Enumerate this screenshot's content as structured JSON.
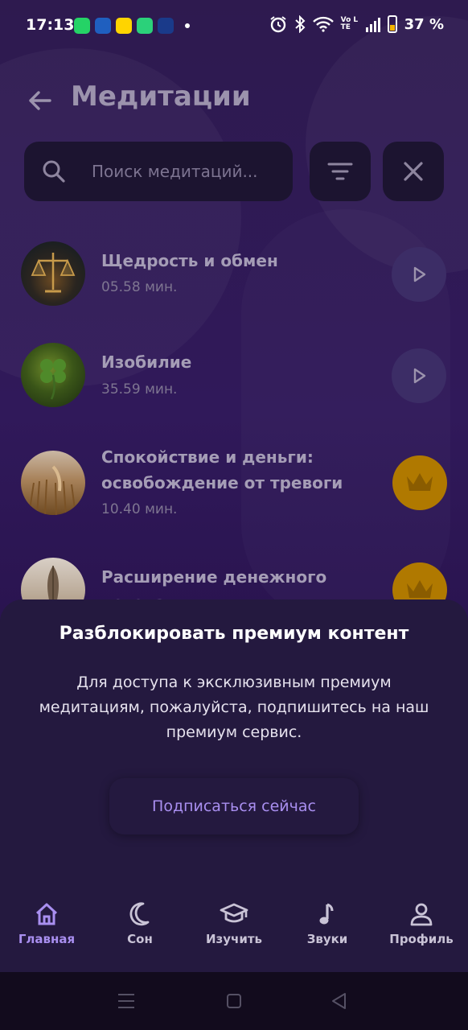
{
  "status_bar": {
    "time": "17:13",
    "battery": "37 %",
    "volte_label": "Vo LTE"
  },
  "header": {
    "title": "Медитации"
  },
  "search": {
    "placeholder": "Поиск медитаций..."
  },
  "meditations": [
    {
      "title": "Щедрость и обмен",
      "duration": "05.58 мин.",
      "action": "play"
    },
    {
      "title": "Изобилие",
      "duration": "35.59 мин.",
      "action": "play"
    },
    {
      "title": "Спокойствие и деньги: освобождение от тревоги",
      "duration": "10.40 мин.",
      "action": "premium"
    },
    {
      "title": "Расширение денежного потока",
      "duration": "",
      "action": "premium"
    }
  ],
  "premium_sheet": {
    "title": "Разблокировать премиум контент",
    "text": "Для доступа к эксклюзивным премиум медитациям, пожалуйста, подпишитесь на наш премиум сервис.",
    "button": "Подписаться сейчас"
  },
  "bottom_nav": {
    "items": [
      {
        "label": "Главная",
        "icon": "home-icon",
        "active": true
      },
      {
        "label": "Сон",
        "icon": "moon-icon",
        "active": false
      },
      {
        "label": "Изучить",
        "icon": "graduation-cap-icon",
        "active": false
      },
      {
        "label": "Звуки",
        "icon": "music-note-icon",
        "active": false
      },
      {
        "label": "Профиль",
        "icon": "user-icon",
        "active": false
      }
    ]
  },
  "colors": {
    "accent": "#a98ff0",
    "background": "#2e1a4f",
    "sheet": "#24193f",
    "premium": "#b07900"
  }
}
